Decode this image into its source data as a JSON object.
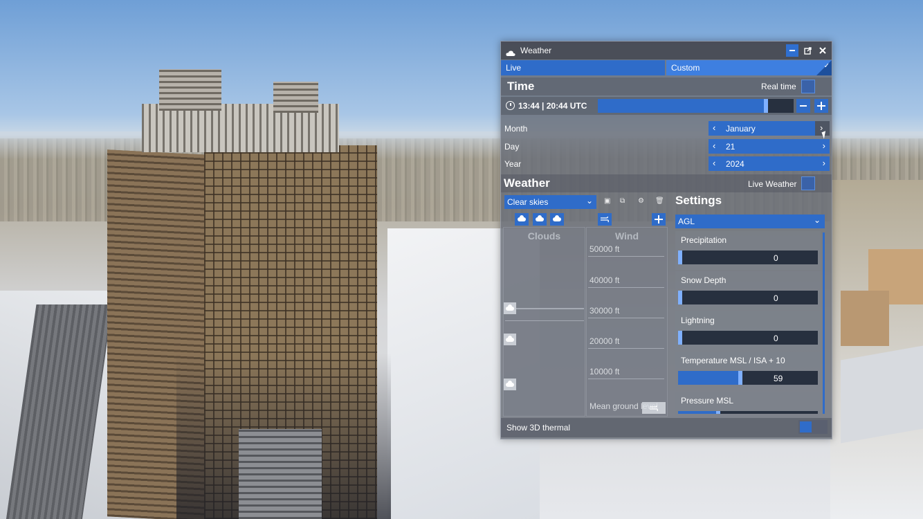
{
  "window": {
    "title": "Weather"
  },
  "modes": {
    "live": "Live",
    "custom": "Custom"
  },
  "time": {
    "section_title": "Time",
    "real_time_label": "Real time",
    "display": "13:44 | 20:44 UTC",
    "slider_fraction": 0.87
  },
  "date": {
    "month": {
      "label": "Month",
      "value": "January"
    },
    "day": {
      "label": "Day",
      "value": "21"
    },
    "year": {
      "label": "Year",
      "value": "2024"
    }
  },
  "weather": {
    "section_title": "Weather",
    "live_weather_label": "Live Weather",
    "preset": "Clear skies",
    "clouds_title": "Clouds",
    "wind_title": "Wind",
    "altitudes": [
      "50000 ft",
      "40000 ft",
      "30000 ft",
      "20000 ft",
      "10000 ft",
      "Mean ground level"
    ]
  },
  "settings": {
    "title": "Settings",
    "altitude_ref": "AGL",
    "items": [
      {
        "label": "Precipitation",
        "value": "0",
        "fraction": 0.0
      },
      {
        "label": "Snow Depth",
        "value": "0",
        "fraction": 0.0
      },
      {
        "label": "Lightning",
        "value": "0",
        "fraction": 0.0
      },
      {
        "label": "Temperature MSL / ISA + 10",
        "value": "59",
        "fraction": 0.46
      },
      {
        "label": "Pressure MSL",
        "value": "",
        "fraction": 0.3
      }
    ]
  },
  "thermal": {
    "label": "Show 3D thermal"
  },
  "colors": {
    "accent": "#2f6cc9",
    "panel": "#696e78"
  }
}
